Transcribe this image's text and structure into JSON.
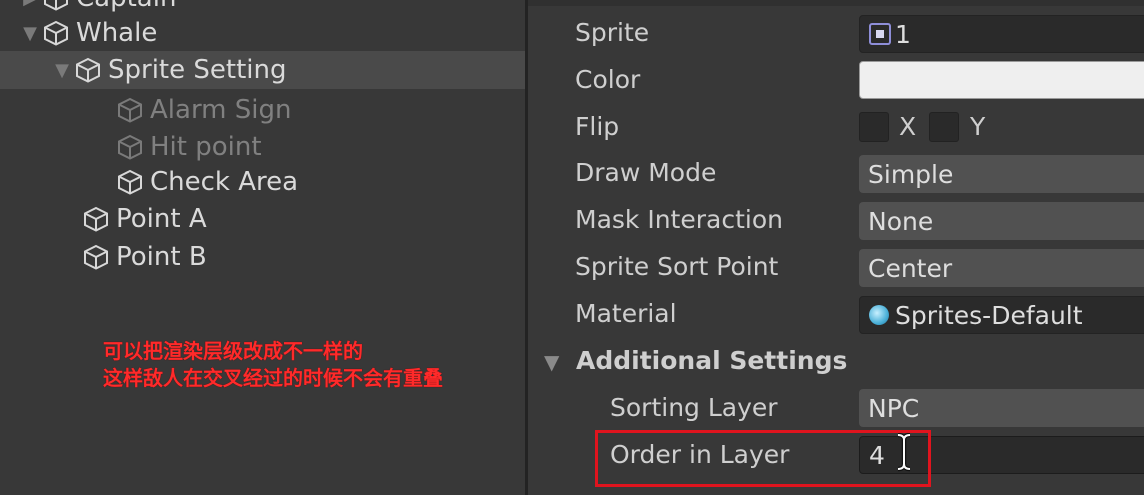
{
  "hierarchy": {
    "items": [
      {
        "label": "Captain",
        "indent": 0,
        "foldout": "closed",
        "state": "normal"
      },
      {
        "label": "Whale",
        "indent": 0,
        "foldout": "open",
        "state": "normal"
      },
      {
        "label": "Sprite Setting",
        "indent": 1,
        "foldout": "open",
        "state": "selected"
      },
      {
        "label": "Alarm Sign",
        "indent": 2,
        "foldout": "none",
        "state": "disabled"
      },
      {
        "label": "Hit point",
        "indent": 2,
        "foldout": "none",
        "state": "disabled"
      },
      {
        "label": "Check Area",
        "indent": 2,
        "foldout": "none",
        "state": "normal"
      },
      {
        "label": "Point A",
        "indent": 1,
        "foldout": "none",
        "state": "normal"
      },
      {
        "label": "Point B",
        "indent": 1,
        "foldout": "none",
        "state": "normal"
      }
    ]
  },
  "annotation": {
    "line1": "可以把渲染层级改成不一样的",
    "line2": "这样敌人在交叉经过的时候不会有重叠"
  },
  "inspector": {
    "sprite": {
      "label": "Sprite",
      "value": "1"
    },
    "color": {
      "label": "Color",
      "value": "#efefef"
    },
    "flip": {
      "label": "Flip",
      "x_label": "X",
      "y_label": "Y",
      "x_checked": false,
      "y_checked": false
    },
    "draw_mode": {
      "label": "Draw Mode",
      "value": "Simple"
    },
    "mask_interaction": {
      "label": "Mask Interaction",
      "value": "None"
    },
    "sprite_sort_point": {
      "label": "Sprite Sort Point",
      "value": "Center"
    },
    "material": {
      "label": "Material",
      "value": "Sprites-Default"
    },
    "additional_settings": {
      "title": "Additional Settings",
      "sorting_layer": {
        "label": "Sorting Layer",
        "value": "NPC"
      },
      "order_in_layer": {
        "label": "Order in Layer",
        "value": "4"
      }
    }
  },
  "colors": {
    "panel_bg": "#383838",
    "selection": "#4a4a4a",
    "annotation_red": "#ff2a2a",
    "highlight_border": "#e0141e"
  }
}
